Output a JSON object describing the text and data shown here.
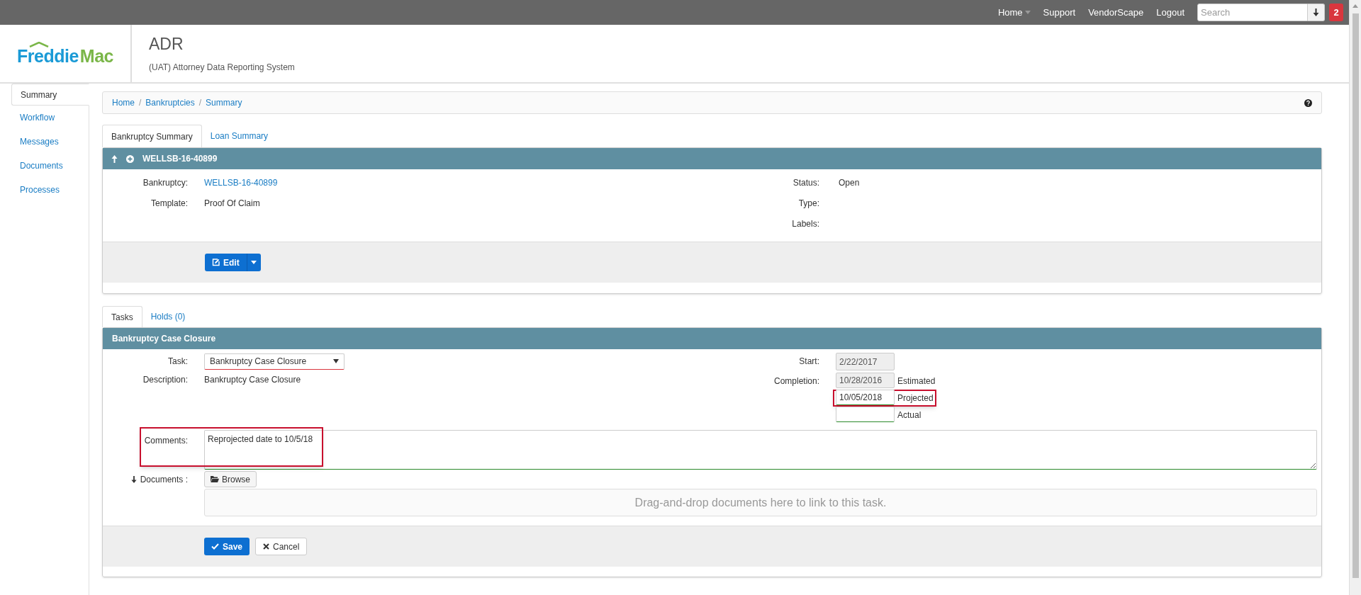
{
  "top_nav": {
    "links": [
      {
        "label": "Home",
        "has_caret": true
      },
      {
        "label": "Support",
        "has_caret": false
      },
      {
        "label": "VendorScape",
        "has_caret": false
      },
      {
        "label": "Logout",
        "has_caret": false
      }
    ],
    "search": {
      "placeholder": "Search"
    },
    "notification_count": "2"
  },
  "header": {
    "logo": {
      "part_1": "Freddie",
      "part_2": "Mac"
    },
    "title": "ADR",
    "subtitle": "(UAT) Attorney Data Reporting System"
  },
  "sidebar": {
    "items": [
      {
        "label": "Summary",
        "selected": true
      },
      {
        "label": "Workflow",
        "selected": false
      },
      {
        "label": "Messages",
        "selected": false
      },
      {
        "label": "Documents",
        "selected": false
      },
      {
        "label": "Processes",
        "selected": false
      }
    ]
  },
  "breadcrumb": {
    "separator": "/",
    "items": [
      "Home",
      "Bankruptcies",
      "Summary"
    ]
  },
  "summary_tabs": [
    {
      "label": "Bankruptcy Summary",
      "selected": true
    },
    {
      "label": "Loan Summary",
      "selected": false
    }
  ],
  "summary_panel": {
    "title": "WELLSB-16-40899",
    "left_fields": [
      {
        "label": "Bankruptcy:",
        "value": "WELLSB-16-40899",
        "kind": "link"
      },
      {
        "label": "Template:",
        "value": "Proof Of Claim",
        "kind": "text"
      }
    ],
    "right_fields": [
      {
        "label": "Status:",
        "value": "Open"
      },
      {
        "label": "Type:"
      },
      {
        "label": "Labels:"
      }
    ],
    "edit_button": "Edit"
  },
  "task_tabs": [
    {
      "label": "Tasks",
      "selected": true
    },
    {
      "label": "Holds (0)",
      "selected": false
    }
  ],
  "task_panel": {
    "title": "Bankruptcy Case Closure",
    "task": {
      "label": "Task:",
      "value": "Bankruptcy Case Closure"
    },
    "description": {
      "label": "Description:",
      "value": "Bankruptcy Case Closure"
    },
    "start": {
      "label": "Start:",
      "value": "2/22/2017"
    },
    "completion_label": "Completion:",
    "completion_dates": [
      {
        "value": "10/28/2016",
        "note": "Estimated",
        "disabled": true,
        "highlighted": false
      },
      {
        "value": "10/05/2018",
        "note": "Projected",
        "disabled": false,
        "highlighted": true
      },
      {
        "note": "Actual",
        "disabled": false,
        "highlighted": false
      }
    ],
    "comments": {
      "label": "Comments:",
      "value": "Reprojected date to 10/5/18",
      "highlighted": true
    },
    "documents": {
      "label": "Documents :",
      "browse": "Browse",
      "dropzone": "Drag-and-drop documents here to link to this task."
    },
    "buttons": [
      {
        "label": "Save",
        "kind": "primary"
      },
      {
        "label": "Cancel",
        "kind": "default"
      }
    ]
  }
}
